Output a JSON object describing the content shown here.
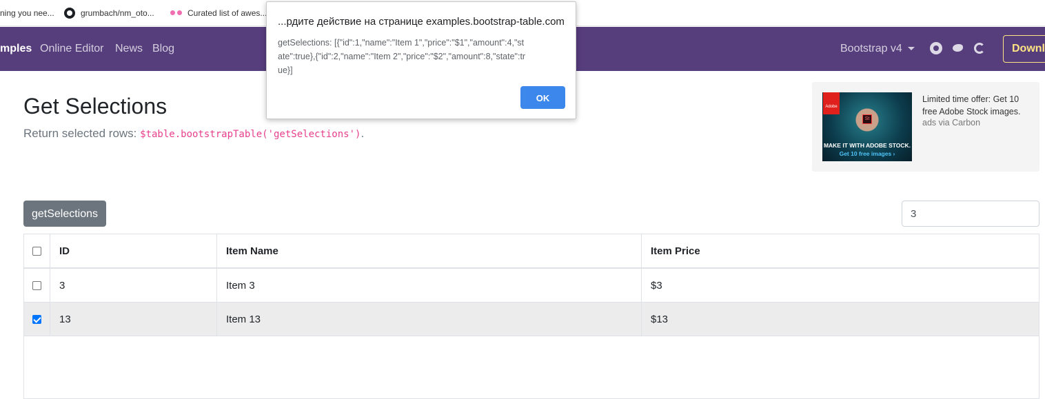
{
  "bookmarks": [
    {
      "label": "ning you nee..."
    },
    {
      "label": "grumbach/nm_oto..."
    },
    {
      "label": "Curated list of awes..."
    }
  ],
  "nav": {
    "examples": "mples",
    "online_editor": "Online Editor",
    "news": "News",
    "blog": "Blog",
    "bootstrap_version": "Bootstrap v4",
    "download": "Downlo"
  },
  "page": {
    "title": "Get Selections",
    "lead_text": "Return selected rows: ",
    "lead_code": "$table.bootstrapTable('getSelections')",
    "lead_end": "."
  },
  "ad": {
    "image_tagline": "MAKE IT WITH ADOBE STOCK.",
    "image_sub": "Get 10 free images ›",
    "adobe": "Adobe",
    "st": "St",
    "text": "Limited time offer: Get 10 free Adobe Stock images.",
    "via": "ads via Carbon"
  },
  "toolbar": {
    "get_selections_label": "getSelections",
    "search_value": "3"
  },
  "table": {
    "columns": [
      "ID",
      "Item Name",
      "Item Price"
    ],
    "rows": [
      {
        "checked": false,
        "id": "3",
        "name": "Item 3",
        "price": "$3"
      },
      {
        "checked": true,
        "id": "13",
        "name": "Item 13",
        "price": "$13"
      }
    ]
  },
  "dialog": {
    "title": "...рдите действие на странице examples.bootstrap-table.com",
    "message": "getSelections: [{\"id\":1,\"name\":\"Item 1\",\"price\":\"$1\",\"amount\":4,\"state\":true},{\"id\":2,\"name\":\"Item 2\",\"price\":\"$2\",\"amount\":8,\"state\":true}]",
    "ok_label": "OK"
  },
  "colors": {
    "navbar": "#563d7c",
    "download_accent": "#ffe484",
    "button_secondary": "#6c757d",
    "ok_button": "#1a73e8",
    "code": "#e83e8c"
  },
  "icons": {
    "bookmark_2": "github-icon",
    "bookmark_3": "glasses-icon",
    "nav_1": "github-icon",
    "nav_2": "twitter-icon",
    "nav_3": "opencollective-icon"
  }
}
